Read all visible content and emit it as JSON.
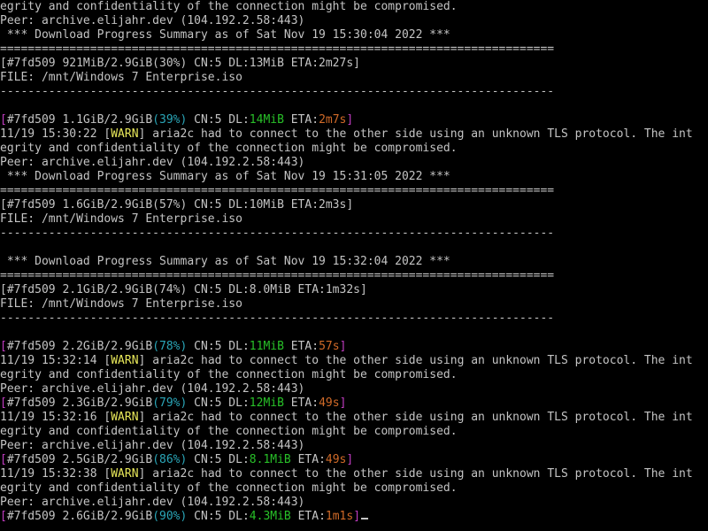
{
  "terminal": {
    "colors": {
      "default": "#c4c4c4",
      "magenta": "#c03cc0",
      "cyan": "#2aa6b8",
      "green": "#28c028",
      "orange": "#d06a28",
      "yellow": "#e8e85a",
      "background": "#000000"
    },
    "lines": [
      [
        {
          "t": "egrity and confidentiality of the connection might be compromised."
        }
      ],
      [
        {
          "t": "Peer: archive.elijahr.dev (104.192.2.58:443)"
        }
      ],
      [
        {
          "t": " *** Download Progress Summary as of Sat Nov 19 15:30:04 2022 ***"
        }
      ],
      [
        {
          "t": "================================================================================"
        }
      ],
      [
        {
          "t": "[#7fd509 921MiB/2.9GiB(30%) CN:5 DL:13MiB ETA:2m27s]"
        }
      ],
      [
        {
          "t": "FILE: /mnt/Windows 7 Enterprise.iso"
        }
      ],
      [
        {
          "t": "--------------------------------------------------------------------------------"
        }
      ],
      [
        {
          "t": ""
        }
      ],
      [
        {
          "t": "[",
          "c": "magenta"
        },
        {
          "t": "#7fd509 1.1GiB/2.9GiB"
        },
        {
          "t": "(39%)",
          "c": "cyan"
        },
        {
          "t": " CN:5 DL:"
        },
        {
          "t": "14MiB",
          "c": "green"
        },
        {
          "t": " ETA:"
        },
        {
          "t": "2m7s",
          "c": "orange"
        },
        {
          "t": "]",
          "c": "magenta"
        }
      ],
      [
        {
          "t": "11/19 15:30:22 ["
        },
        {
          "t": "WARN",
          "c": "yellow"
        },
        {
          "t": "] aria2c had to connect to the other side using an unknown TLS protocol. The int"
        }
      ],
      [
        {
          "t": "egrity and confidentiality of the connection might be compromised."
        }
      ],
      [
        {
          "t": "Peer: archive.elijahr.dev (104.192.2.58:443)"
        }
      ],
      [
        {
          "t": " *** Download Progress Summary as of Sat Nov 19 15:31:05 2022 ***"
        }
      ],
      [
        {
          "t": "================================================================================"
        }
      ],
      [
        {
          "t": "[#7fd509 1.6GiB/2.9GiB(57%) CN:5 DL:10MiB ETA:2m3s]"
        }
      ],
      [
        {
          "t": "FILE: /mnt/Windows 7 Enterprise.iso"
        }
      ],
      [
        {
          "t": "--------------------------------------------------------------------------------"
        }
      ],
      [
        {
          "t": ""
        }
      ],
      [
        {
          "t": " *** Download Progress Summary as of Sat Nov 19 15:32:04 2022 ***"
        }
      ],
      [
        {
          "t": "================================================================================"
        }
      ],
      [
        {
          "t": "[#7fd509 2.1GiB/2.9GiB(74%) CN:5 DL:8.0MiB ETA:1m32s]"
        }
      ],
      [
        {
          "t": "FILE: /mnt/Windows 7 Enterprise.iso"
        }
      ],
      [
        {
          "t": "--------------------------------------------------------------------------------"
        }
      ],
      [
        {
          "t": ""
        }
      ],
      [
        {
          "t": "[",
          "c": "magenta"
        },
        {
          "t": "#7fd509 2.2GiB/2.9GiB"
        },
        {
          "t": "(78%)",
          "c": "cyan"
        },
        {
          "t": " CN:5 DL:"
        },
        {
          "t": "11MiB",
          "c": "green"
        },
        {
          "t": " ETA:"
        },
        {
          "t": "57s",
          "c": "orange"
        },
        {
          "t": "]",
          "c": "magenta"
        }
      ],
      [
        {
          "t": "11/19 15:32:14 ["
        },
        {
          "t": "WARN",
          "c": "yellow"
        },
        {
          "t": "] aria2c had to connect to the other side using an unknown TLS protocol. The int"
        }
      ],
      [
        {
          "t": "egrity and confidentiality of the connection might be compromised."
        }
      ],
      [
        {
          "t": "Peer: archive.elijahr.dev (104.192.2.58:443)"
        }
      ],
      [
        {
          "t": "[",
          "c": "magenta"
        },
        {
          "t": "#7fd509 2.3GiB/2.9GiB"
        },
        {
          "t": "(79%)",
          "c": "cyan"
        },
        {
          "t": " CN:5 DL:"
        },
        {
          "t": "12MiB",
          "c": "green"
        },
        {
          "t": " ETA:"
        },
        {
          "t": "49s",
          "c": "orange"
        },
        {
          "t": "]",
          "c": "magenta"
        }
      ],
      [
        {
          "t": "11/19 15:32:16 ["
        },
        {
          "t": "WARN",
          "c": "yellow"
        },
        {
          "t": "] aria2c had to connect to the other side using an unknown TLS protocol. The int"
        }
      ],
      [
        {
          "t": "egrity and confidentiality of the connection might be compromised."
        }
      ],
      [
        {
          "t": "Peer: archive.elijahr.dev (104.192.2.58:443)"
        }
      ],
      [
        {
          "t": "[",
          "c": "magenta"
        },
        {
          "t": "#7fd509 2.5GiB/2.9GiB"
        },
        {
          "t": "(86%)",
          "c": "cyan"
        },
        {
          "t": " CN:5 DL:"
        },
        {
          "t": "8.1MiB",
          "c": "green"
        },
        {
          "t": " ETA:"
        },
        {
          "t": "49s",
          "c": "orange"
        },
        {
          "t": "]",
          "c": "magenta"
        }
      ],
      [
        {
          "t": "11/19 15:32:38 ["
        },
        {
          "t": "WARN",
          "c": "yellow"
        },
        {
          "t": "] aria2c had to connect to the other side using an unknown TLS protocol. The int"
        }
      ],
      [
        {
          "t": "egrity and confidentiality of the connection might be compromised."
        }
      ],
      [
        {
          "t": "Peer: archive.elijahr.dev (104.192.2.58:443)"
        }
      ],
      [
        {
          "t": "[",
          "c": "magenta"
        },
        {
          "t": "#7fd509 2.6GiB/2.9GiB"
        },
        {
          "t": "(90%)",
          "c": "cyan"
        },
        {
          "t": " CN:5 DL:"
        },
        {
          "t": "4.3MiB",
          "c": "green"
        },
        {
          "t": " ETA:"
        },
        {
          "t": "1m1s",
          "c": "orange"
        },
        {
          "t": "]",
          "c": "magenta"
        }
      ]
    ],
    "cursor_after_last_line": true
  }
}
